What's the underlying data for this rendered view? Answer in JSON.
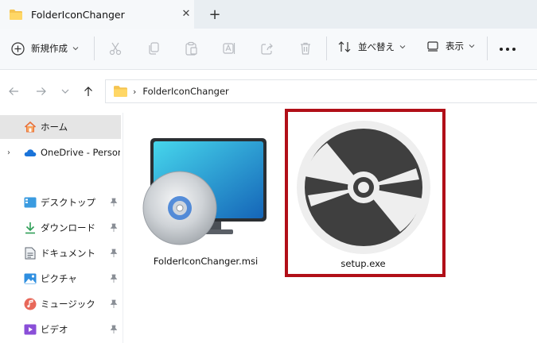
{
  "tab": {
    "title": "FolderIconChanger",
    "close": "✕",
    "new_tab": "+"
  },
  "toolbar": {
    "new_label": "新規作成",
    "sort_label": "並べ替え",
    "view_label": "表示"
  },
  "address": {
    "crumb": "FolderIconChanger"
  },
  "sidebar": {
    "items": [
      {
        "label": "ホーム"
      },
      {
        "label": "OneDrive - Persona"
      },
      {
        "label": "デスクトップ"
      },
      {
        "label": "ダウンロード"
      },
      {
        "label": "ドキュメント"
      },
      {
        "label": "ピクチャ"
      },
      {
        "label": "ミュージック"
      },
      {
        "label": "ビデオ"
      }
    ]
  },
  "files": [
    {
      "name": "FolderIconChanger.msi"
    },
    {
      "name": "setup.exe"
    }
  ],
  "colors": {
    "highlight": "#b10f18",
    "folder": "#f5c451",
    "accent": "#0a64c8"
  }
}
